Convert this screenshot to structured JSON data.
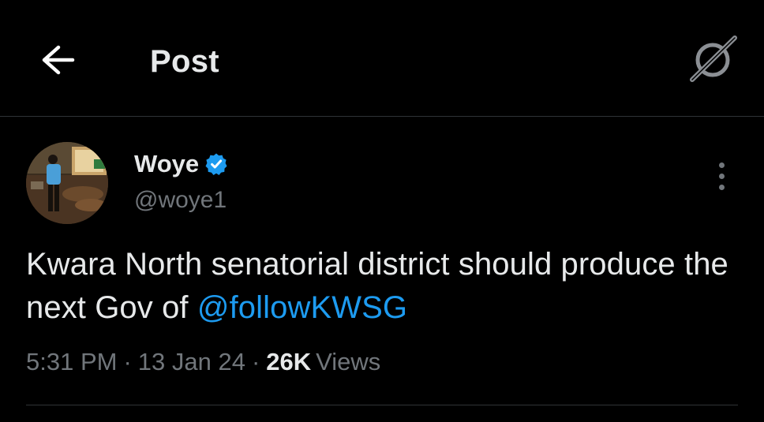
{
  "header": {
    "title": "Post",
    "back_icon": "arrow-left-icon",
    "grok_icon": "grok-icon"
  },
  "author": {
    "name": "Woye",
    "handle": "@woye1",
    "verified": true,
    "verified_color": "#1d9bf0"
  },
  "post": {
    "text_before_mention": "Kwara North senatorial district should produce the next Gov of ",
    "mention": "@followKWSG",
    "mention_color": "#1d9bf0"
  },
  "meta": {
    "time": "5:31 PM",
    "separator": "·",
    "date": "13 Jan 24",
    "views_count": "26K",
    "views_label": "Views"
  }
}
